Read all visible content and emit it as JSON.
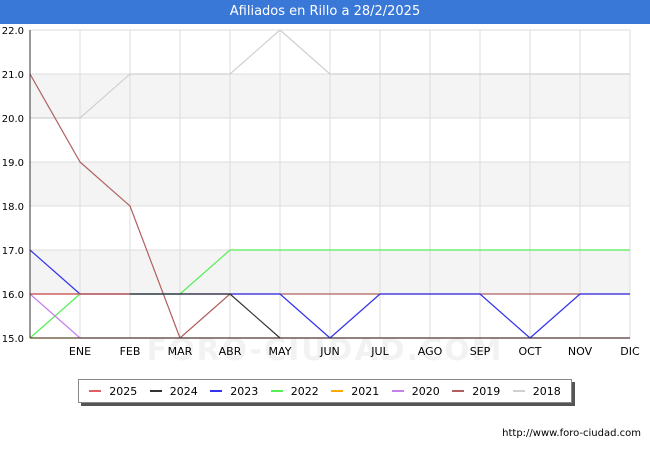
{
  "title": "Afiliados en Rillo a 28/2/2025",
  "source": "http://www.foro-ciudad.com",
  "watermark": "FORO-CIUDAD.COM",
  "chart_data": {
    "type": "line",
    "title": "Afiliados en Rillo a 28/2/2025",
    "xlabel": "",
    "ylabel": "",
    "categories": [
      "",
      "ENE",
      "FEB",
      "MAR",
      "ABR",
      "MAY",
      "JUN",
      "JUL",
      "AGO",
      "SEP",
      "OCT",
      "NOV",
      "DIC"
    ],
    "y_ticks": [
      "15.0",
      "16.0",
      "17.0",
      "18.0",
      "19.0",
      "20.0",
      "21.0",
      "22.0"
    ],
    "ylim": [
      15,
      22
    ],
    "grid": true,
    "legend_position": "bottom",
    "series": [
      {
        "name": "2018",
        "color": "#d0d0d0",
        "values": [
          20,
          20,
          21,
          21,
          21,
          22,
          21,
          21,
          21,
          21,
          21,
          21,
          21
        ]
      },
      {
        "name": "2022",
        "color": "#55ee55",
        "values": [
          15,
          16,
          16,
          16,
          17,
          17,
          17,
          17,
          17,
          17,
          17,
          17,
          17
        ]
      },
      {
        "name": "2021",
        "color": "#ffaa00",
        "values": [
          15,
          15,
          15,
          15,
          15,
          15,
          15,
          15,
          15,
          15,
          15,
          15,
          15
        ]
      },
      {
        "name": "2020",
        "color": "#c77fea",
        "values": [
          16,
          15,
          15,
          15,
          15,
          15,
          15,
          15,
          15,
          15,
          15,
          15,
          15
        ]
      },
      {
        "name": "2019",
        "color": "#b06060",
        "values": [
          21,
          19,
          18,
          15,
          16,
          16,
          16,
          16,
          16,
          16,
          16,
          16,
          16
        ]
      },
      {
        "name": "2023",
        "color": "#3333ee",
        "values": [
          17,
          16,
          16,
          16,
          16,
          16,
          15,
          16,
          16,
          16,
          15,
          16,
          16
        ]
      },
      {
        "name": "2024",
        "color": "#333333",
        "values": [
          16,
          16,
          16,
          16,
          16,
          15,
          null,
          null,
          null,
          null,
          null,
          null,
          null
        ]
      },
      {
        "name": "2025",
        "color": "#e06060",
        "values": [
          16,
          16,
          16,
          null,
          null,
          null,
          null,
          null,
          null,
          null,
          null,
          null,
          null
        ]
      }
    ],
    "legend_order": [
      "2025",
      "2024",
      "2023",
      "2022",
      "2021",
      "2020",
      "2019",
      "2018"
    ]
  }
}
